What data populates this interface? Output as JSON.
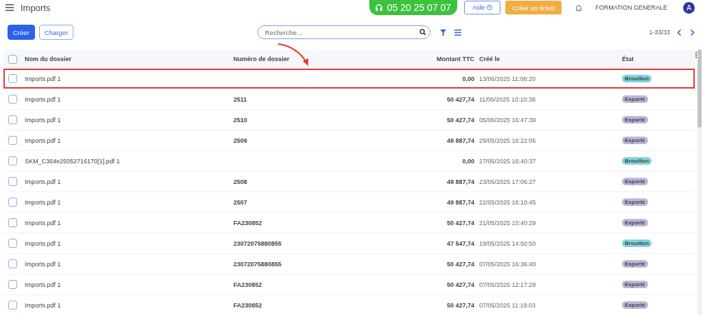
{
  "header": {
    "title": "Imports",
    "phone": "05 20 25 07 07",
    "help_button": "Aide",
    "ticket_button": "Créer un ticket",
    "account": "FORMATION GENERALE",
    "avatar": "A"
  },
  "toolbar": {
    "create_button": "Créer",
    "load_button": "Charger",
    "search": {
      "placeholder": "Recherche..."
    },
    "pagination": "1-33/33"
  },
  "table": {
    "columns": [
      "Nom du dossier",
      "Numéro de dossier",
      "Montant TTC",
      "Créé le",
      "État"
    ],
    "all_checked": false,
    "rows": [
      {
        "name": "Imports.pdf 1",
        "number": "",
        "amount": "0,00",
        "created": "13/06/2025 11:08:20",
        "status": "Brouillon",
        "color": "#7fd3dc",
        "checked": false,
        "highlighted": true
      },
      {
        "name": "Imports.pdf 1",
        "number": "2511",
        "amount": "50 427,74",
        "created": "11/06/2025 10:10:38",
        "status": "Exporté",
        "color": "#bdb6db",
        "checked": false,
        "highlighted": false
      },
      {
        "name": "Imports.pdf 1",
        "number": "2510",
        "amount": "50 427,74",
        "created": "05/06/2025 16:47:39",
        "status": "Exporté",
        "color": "#bdb6db",
        "checked": false,
        "highlighted": false
      },
      {
        "name": "Imports.pdf 1",
        "number": "2509",
        "amount": "49 887,74",
        "created": "29/05/2025 16:22:05",
        "status": "Exporté",
        "color": "#bdb6db",
        "checked": false,
        "highlighted": false
      },
      {
        "name": "SKM_C364e25052716170[1].pdf 1",
        "number": "",
        "amount": "0,00",
        "created": "27/05/2025 16:40:37",
        "status": "Brouillon",
        "color": "#7fd3dc",
        "checked": false,
        "highlighted": false
      },
      {
        "name": "Imports.pdf 1",
        "number": "2508",
        "amount": "49 887,74",
        "created": "23/05/2025 17:06:27",
        "status": "Exporté",
        "color": "#bdb6db",
        "checked": false,
        "highlighted": false
      },
      {
        "name": "Imports.pdf 1",
        "number": "2507",
        "amount": "49 887,74",
        "created": "22/05/2025 16:10:45",
        "status": "Exporté",
        "color": "#bdb6db",
        "checked": false,
        "highlighted": false
      },
      {
        "name": "Imports.pdf 1",
        "number": "FA230852",
        "amount": "50 427,74",
        "created": "21/05/2025 15:40:29",
        "status": "Exporté",
        "color": "#bdb6db",
        "checked": false,
        "highlighted": false
      },
      {
        "name": "Imports.pdf 1",
        "number": "23072075880855",
        "amount": "47 547,74",
        "created": "19/05/2025 14:50:50",
        "status": "Brouillon",
        "color": "#7fd3dc",
        "checked": false,
        "highlighted": false
      },
      {
        "name": "Imports.pdf 1",
        "number": "23072075880855",
        "amount": "50 427,74",
        "created": "07/05/2025 16:36:40",
        "status": "Exporté",
        "color": "#bdb6db",
        "checked": false,
        "highlighted": false
      },
      {
        "name": "Imports.pdf 1",
        "number": "FA230852",
        "amount": "50 427,74",
        "created": "07/05/2025 12:17:28",
        "status": "Exporté",
        "color": "#bdb6db",
        "checked": false,
        "highlighted": false
      },
      {
        "name": "Imports.pdf 1",
        "number": "FA230852",
        "amount": "50 427,74",
        "created": "07/05/2025 11:19:03",
        "status": "Exporté",
        "color": "#bdb6db",
        "checked": false,
        "highlighted": false
      }
    ]
  }
}
